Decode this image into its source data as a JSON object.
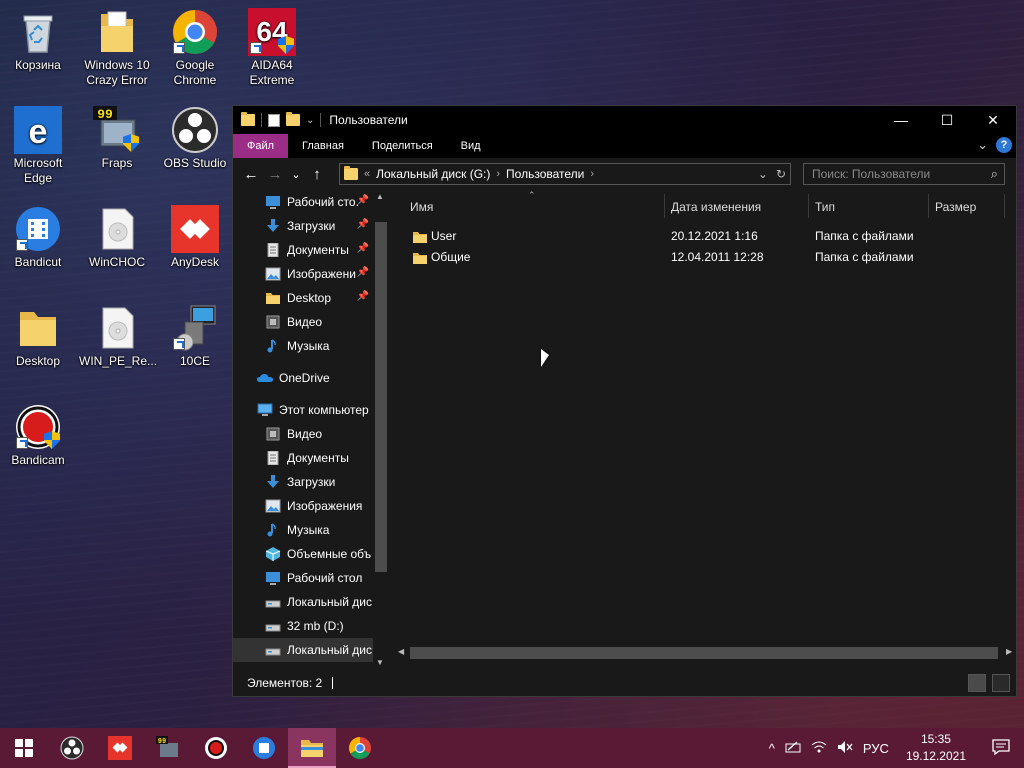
{
  "desktop": {
    "icons": [
      {
        "label": "Корзина"
      },
      {
        "label": "Windows 10 Crazy Error"
      },
      {
        "label": "Google Chrome"
      },
      {
        "label": "AIDA64 Extreme",
        "badge": "64"
      },
      {
        "label": "Microsoft Edge"
      },
      {
        "label": "Fraps",
        "badge": "99"
      },
      {
        "label": "OBS Studio"
      },
      {
        "label": "Bandicut"
      },
      {
        "label": "WinCHOC"
      },
      {
        "label": "AnyDesk"
      },
      {
        "label": "Desktop"
      },
      {
        "label": "WIN_PE_Re..."
      },
      {
        "label": "10CE"
      },
      {
        "label": "Bandicam"
      }
    ]
  },
  "window": {
    "title": "Пользователи",
    "controls": {
      "minimize": "—",
      "maximize": "☐",
      "close": "✕"
    },
    "ribbon": {
      "tabs": [
        "Файл",
        "Главная",
        "Поделиться",
        "Вид"
      ],
      "expand": "⌄",
      "help": "?"
    },
    "address": {
      "back": "←",
      "forward": "→",
      "recent": "⌄",
      "up": "↑",
      "overflow": "«",
      "crumbs": [
        "Локальный диск (G:)",
        "Пользователи"
      ],
      "sep": "›",
      "dropdown": "⌄",
      "refresh": "↻"
    },
    "search": {
      "placeholder": "Поиск: Пользователи",
      "icon": "⌕"
    },
    "nav_pane": {
      "quick_access": [
        {
          "label": "Рабочий сто.",
          "icon": "desktop-icon",
          "pinned": true
        },
        {
          "label": "Загрузки",
          "icon": "download-icon",
          "pinned": true
        },
        {
          "label": "Документы",
          "icon": "documents-icon",
          "pinned": true
        },
        {
          "label": "Изображени",
          "icon": "pictures-icon",
          "pinned": true
        },
        {
          "label": "Desktop",
          "icon": "folder-icon",
          "pinned": true
        },
        {
          "label": "Видео",
          "icon": "video-icon",
          "pinned": false
        },
        {
          "label": "Музыка",
          "icon": "music-icon",
          "pinned": false
        }
      ],
      "onedrive": "OneDrive",
      "this_pc": "Этот компьютер",
      "this_pc_items": [
        {
          "label": "Видео",
          "icon": "video-icon"
        },
        {
          "label": "Документы",
          "icon": "documents-icon"
        },
        {
          "label": "Загрузки",
          "icon": "download-icon"
        },
        {
          "label": "Изображения",
          "icon": "pictures-icon"
        },
        {
          "label": "Музыка",
          "icon": "music-icon"
        },
        {
          "label": "Объемные объ",
          "icon": "3d-objects-icon"
        },
        {
          "label": "Рабочий стол",
          "icon": "desktop-icon"
        },
        {
          "label": "Локальный дис",
          "icon": "drive-icon"
        },
        {
          "label": "32 mb (D:)",
          "icon": "drive-icon"
        },
        {
          "label": "Локальный дис",
          "icon": "drive-icon",
          "selected": true
        }
      ],
      "pin_glyph": "📌"
    },
    "columns": {
      "name": "Имя",
      "date": "Дата изменения",
      "type": "Тип",
      "size": "Размер",
      "sort_glyph": "⌃"
    },
    "files": [
      {
        "name": "User",
        "date": "20.12.2021 1:16",
        "type": "Папка с файлами"
      },
      {
        "name": "Общие",
        "date": "12.04.2011 12:28",
        "type": "Папка с файлами"
      }
    ],
    "status": {
      "items": "Элементов: 2"
    }
  },
  "taskbar": {
    "start": "start-icon",
    "apps": [
      "obs-icon",
      "anydesk-icon",
      "fraps-icon",
      "bandicam-icon",
      "bandicut-icon",
      "explorer-icon",
      "chrome-icon"
    ],
    "tray": {
      "chevron": "^",
      "lang": "РУС",
      "time": "15:35",
      "date": "19.12.2021"
    }
  },
  "colors": {
    "taskbar": "#5a1a36",
    "file_tab": "#9b2d87",
    "explorer_bg": "#191919",
    "folder": "#f5d26b"
  }
}
